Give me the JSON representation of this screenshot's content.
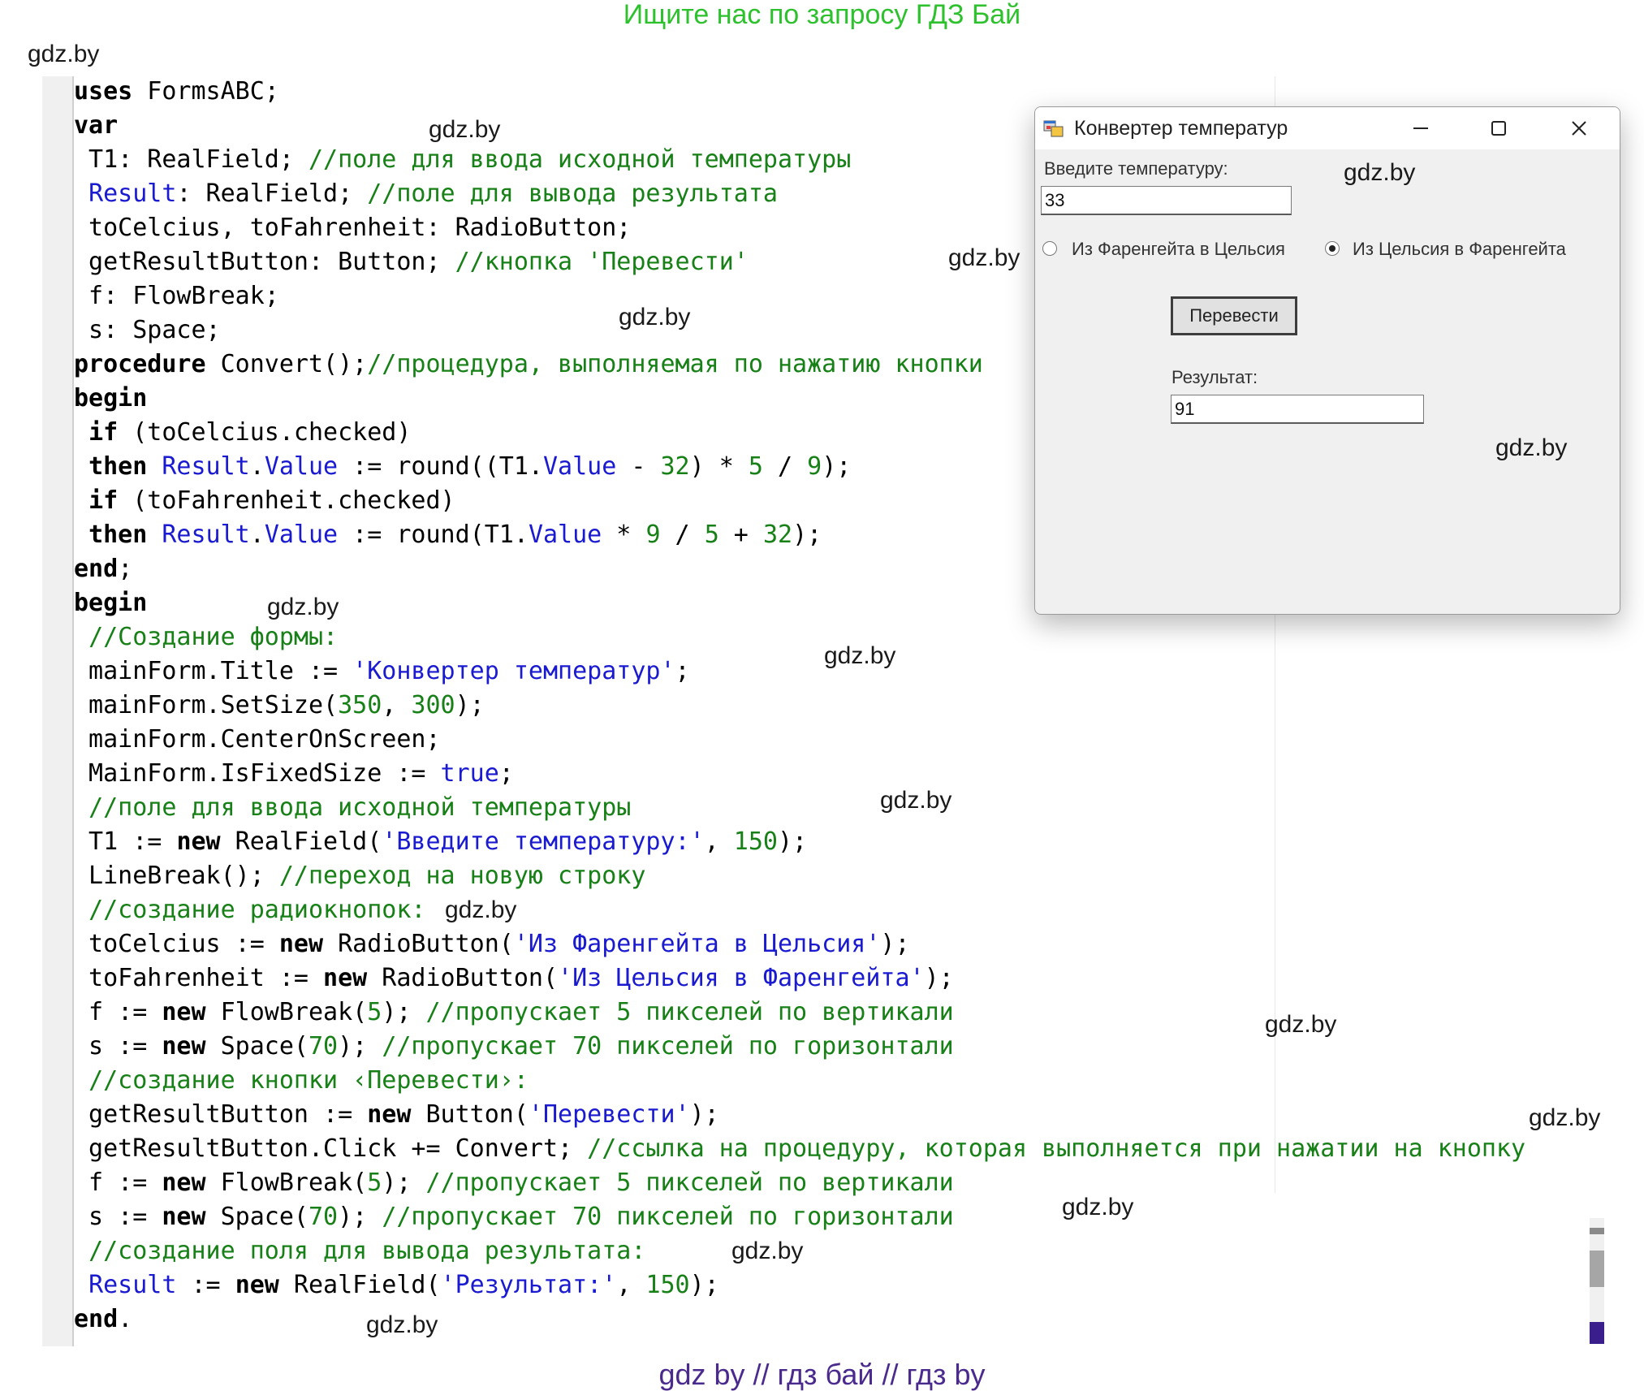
{
  "header": "Ищите нас по запросу ГДЗ Бай",
  "footer": "gdz by  //  гдз бай  //  гдз by",
  "watermark": "gdz.by",
  "code_lines": [
    [
      {
        "t": "uses",
        "c": "kw"
      },
      {
        "t": " FormsABC;"
      }
    ],
    [
      {
        "t": "var",
        "c": "kw"
      }
    ],
    [
      {
        "t": " T1: RealField; "
      },
      {
        "t": "//поле для ввода исходной температуры",
        "c": "cm"
      }
    ],
    [
      {
        "t": " "
      },
      {
        "t": "Result",
        "c": "id"
      },
      {
        "t": ": RealField; "
      },
      {
        "t": "//поле для вывода результата",
        "c": "cm"
      }
    ],
    [
      {
        "t": " toCelcius, toFahrenheit: RadioButton;"
      }
    ],
    [
      {
        "t": " getResultButton: Button; "
      },
      {
        "t": "//кнопка 'Перевести'",
        "c": "cm"
      }
    ],
    [
      {
        "t": " f: FlowBreak;"
      }
    ],
    [
      {
        "t": " s: Space;"
      }
    ],
    [
      {
        "t": "procedure",
        "c": "kw"
      },
      {
        "t": " Convert();"
      },
      {
        "t": "//процедура, выполняемая по нажатию кнопки",
        "c": "cm"
      }
    ],
    [
      {
        "t": "begin",
        "c": "kw"
      }
    ],
    [
      {
        "t": " "
      },
      {
        "t": "if",
        "c": "kw"
      },
      {
        "t": " (toCelcius.checked)"
      }
    ],
    [
      {
        "t": " "
      },
      {
        "t": "then",
        "c": "kw"
      },
      {
        "t": " "
      },
      {
        "t": "Result",
        "c": "id"
      },
      {
        "t": "."
      },
      {
        "t": "Value",
        "c": "id"
      },
      {
        "t": " := round((T1."
      },
      {
        "t": "Value",
        "c": "id"
      },
      {
        "t": " - "
      },
      {
        "t": "32",
        "c": "nu"
      },
      {
        "t": ") * "
      },
      {
        "t": "5",
        "c": "nu"
      },
      {
        "t": " / "
      },
      {
        "t": "9",
        "c": "nu"
      },
      {
        "t": ");"
      }
    ],
    [
      {
        "t": " "
      },
      {
        "t": "if",
        "c": "kw"
      },
      {
        "t": " (toFahrenheit.checked)"
      }
    ],
    [
      {
        "t": " "
      },
      {
        "t": "then",
        "c": "kw"
      },
      {
        "t": " "
      },
      {
        "t": "Result",
        "c": "id"
      },
      {
        "t": "."
      },
      {
        "t": "Value",
        "c": "id"
      },
      {
        "t": " := round(T1."
      },
      {
        "t": "Value",
        "c": "id"
      },
      {
        "t": " * "
      },
      {
        "t": "9",
        "c": "nu"
      },
      {
        "t": " / "
      },
      {
        "t": "5",
        "c": "nu"
      },
      {
        "t": " + "
      },
      {
        "t": "32",
        "c": "nu"
      },
      {
        "t": ");"
      }
    ],
    [
      {
        "t": "end",
        "c": "kw"
      },
      {
        "t": ";"
      }
    ],
    [
      {
        "t": "begin",
        "c": "kw"
      }
    ],
    [
      {
        "t": " "
      },
      {
        "t": "//Создание формы:",
        "c": "cm"
      }
    ],
    [
      {
        "t": " mainForm.Title := "
      },
      {
        "t": "'Конвертер температур'",
        "c": "st"
      },
      {
        "t": ";"
      }
    ],
    [
      {
        "t": " mainForm.SetSize("
      },
      {
        "t": "350",
        "c": "nu"
      },
      {
        "t": ", "
      },
      {
        "t": "300",
        "c": "nu"
      },
      {
        "t": ");"
      }
    ],
    [
      {
        "t": " mainForm.CenterOnScreen;"
      }
    ],
    [
      {
        "t": " MainForm.IsFixedSize := "
      },
      {
        "t": "true",
        "c": "id"
      },
      {
        "t": ";"
      }
    ],
    [
      {
        "t": " "
      },
      {
        "t": "//поле для ввода исходной температуры",
        "c": "cm"
      }
    ],
    [
      {
        "t": " T1 := "
      },
      {
        "t": "new",
        "c": "kw"
      },
      {
        "t": " RealField("
      },
      {
        "t": "'Введите температуру:'",
        "c": "st"
      },
      {
        "t": ", "
      },
      {
        "t": "150",
        "c": "nu"
      },
      {
        "t": ");"
      }
    ],
    [
      {
        "t": " LineBreak(); "
      },
      {
        "t": "//переход на новую строку",
        "c": "cm"
      }
    ],
    [
      {
        "t": " "
      },
      {
        "t": "//создание радиокнопок:",
        "c": "cm"
      }
    ],
    [
      {
        "t": " toCelcius := "
      },
      {
        "t": "new",
        "c": "kw"
      },
      {
        "t": " RadioButton("
      },
      {
        "t": "'Из Фаренгейта в Цельсия'",
        "c": "st"
      },
      {
        "t": ");"
      }
    ],
    [
      {
        "t": " toFahrenheit := "
      },
      {
        "t": "new",
        "c": "kw"
      },
      {
        "t": " RadioButton("
      },
      {
        "t": "'Из Цельсия в Фаренгейта'",
        "c": "st"
      },
      {
        "t": ");"
      }
    ],
    [
      {
        "t": " f := "
      },
      {
        "t": "new",
        "c": "kw"
      },
      {
        "t": " FlowBreak("
      },
      {
        "t": "5",
        "c": "nu"
      },
      {
        "t": "); "
      },
      {
        "t": "//пропускает 5 пикселей по вертикали",
        "c": "cm"
      }
    ],
    [
      {
        "t": " s := "
      },
      {
        "t": "new",
        "c": "kw"
      },
      {
        "t": " Space("
      },
      {
        "t": "70",
        "c": "nu"
      },
      {
        "t": "); "
      },
      {
        "t": "//пропускает 70 пикселей по горизонтали",
        "c": "cm"
      }
    ],
    [
      {
        "t": " "
      },
      {
        "t": "//создание кнопки ‹Перевести›:",
        "c": "cm"
      }
    ],
    [
      {
        "t": " getResultButton := "
      },
      {
        "t": "new",
        "c": "kw"
      },
      {
        "t": " Button("
      },
      {
        "t": "'Перевести'",
        "c": "st"
      },
      {
        "t": ");"
      }
    ],
    [
      {
        "t": " getResultButton.Click += Convert; "
      },
      {
        "t": "//ссылка на процедуру, которая выполняется при нажатии на кнопку",
        "c": "cm"
      }
    ],
    [
      {
        "t": " f := "
      },
      {
        "t": "new",
        "c": "kw"
      },
      {
        "t": " FlowBreak("
      },
      {
        "t": "5",
        "c": "nu"
      },
      {
        "t": "); "
      },
      {
        "t": "//пропускает 5 пикселей по вертикали",
        "c": "cm"
      }
    ],
    [
      {
        "t": " s := "
      },
      {
        "t": "new",
        "c": "kw"
      },
      {
        "t": " Space("
      },
      {
        "t": "70",
        "c": "nu"
      },
      {
        "t": "); "
      },
      {
        "t": "//пропускает 70 пикселей по горизонтали",
        "c": "cm"
      }
    ],
    [
      {
        "t": " "
      },
      {
        "t": "//создание поля для вывода результата:",
        "c": "cm"
      }
    ],
    [
      {
        "t": " "
      },
      {
        "t": "Result",
        "c": "id"
      },
      {
        "t": " := "
      },
      {
        "t": "new",
        "c": "kw"
      },
      {
        "t": " RealField("
      },
      {
        "t": "'Результат:'",
        "c": "st"
      },
      {
        "t": ", "
      },
      {
        "t": "150",
        "c": "nu"
      },
      {
        "t": ");"
      }
    ],
    [
      {
        "t": "end",
        "c": "kw"
      },
      {
        "t": "."
      }
    ]
  ],
  "window": {
    "title": "Конвертер температур",
    "input_label": "Введите температуру:",
    "input_value": "33",
    "radio_to_celsius": "Из Фаренгейта в Цельсия",
    "radio_to_fahrenheit": "Из Цельсия в Фаренгейта",
    "selected_radio": "radio_to_fahrenheit",
    "button_label": "Перевести",
    "result_label": "Результат:",
    "result_value": "91"
  }
}
